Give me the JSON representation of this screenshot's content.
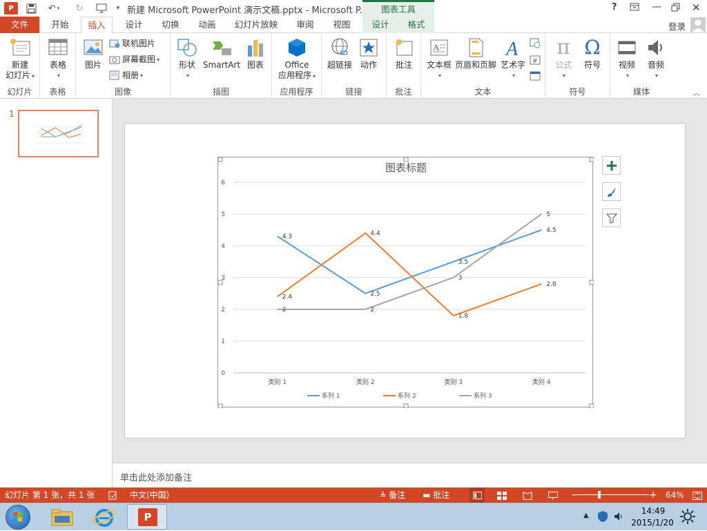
{
  "window": {
    "title": "新建 Microsoft PowerPoint 演示文稿.pptx - Microsoft P...",
    "context_tab_title": "图表工具",
    "help": "?",
    "login": "登录"
  },
  "tabs": {
    "file": "文件",
    "items": [
      "开始",
      "插入",
      "设计",
      "切换",
      "动画",
      "幻灯片放映",
      "审阅",
      "视图"
    ],
    "active": "插入",
    "context": [
      "设计",
      "格式"
    ]
  },
  "ribbon": {
    "slides": {
      "label": "幻灯片",
      "new_slide_line1": "新建",
      "new_slide_line2": "幻灯片"
    },
    "tables": {
      "label": "表格",
      "table": "表格"
    },
    "images": {
      "label": "图像",
      "picture": "图片",
      "online_picture": "联机图片",
      "screenshot": "屏幕截图",
      "album": "相册"
    },
    "illustrations": {
      "label": "插图",
      "shapes": "形状",
      "smartart": "SmartArt",
      "chart": "图表"
    },
    "apps": {
      "label": "应用程序",
      "office_line1": "Office",
      "office_line2": "应用程序"
    },
    "links": {
      "label": "链接",
      "hyperlink": "超链接",
      "action": "动作"
    },
    "comments": {
      "label": "批注",
      "comment": "批注"
    },
    "text": {
      "label": "文本",
      "textbox": "文本框",
      "header_footer": "页眉和页脚",
      "wordart": "艺术字"
    },
    "symbols": {
      "label": "符号",
      "equation": "公式",
      "symbol": "符号"
    },
    "media": {
      "label": "媒体",
      "video": "视频",
      "audio": "音频"
    }
  },
  "thumbnail": {
    "number": "1"
  },
  "notes": {
    "placeholder": "单击此处添加备注"
  },
  "chart_data": {
    "type": "line",
    "title": "图表标题",
    "categories": [
      "类别 1",
      "类别 2",
      "类别 3",
      "类别 4"
    ],
    "ylim": [
      0,
      6
    ],
    "yticks": [
      0,
      1,
      2,
      3,
      4,
      5,
      6
    ],
    "grid": true,
    "legend": "bottom",
    "series": [
      {
        "name": "系列 1",
        "values": [
          4.3,
          2.5,
          3.5,
          4.5
        ],
        "color": "#5b9bd5"
      },
      {
        "name": "系列 2",
        "values": [
          2.4,
          4.4,
          1.8,
          2.8
        ],
        "color": "#ed7d31"
      },
      {
        "name": "系列 3",
        "values": [
          2,
          2,
          3,
          5
        ],
        "color": "#a5a5a5"
      }
    ]
  },
  "status": {
    "slide_info": "幻灯片 第 1 张，共 1 张",
    "language": "中文(中国)",
    "notes": "备注",
    "comments": "批注",
    "zoom": "64%"
  },
  "taskbar": {
    "time": "14:49",
    "date": "2015/1/20"
  },
  "colors": {
    "accent": "#d24726",
    "context_tab": "#217346"
  }
}
